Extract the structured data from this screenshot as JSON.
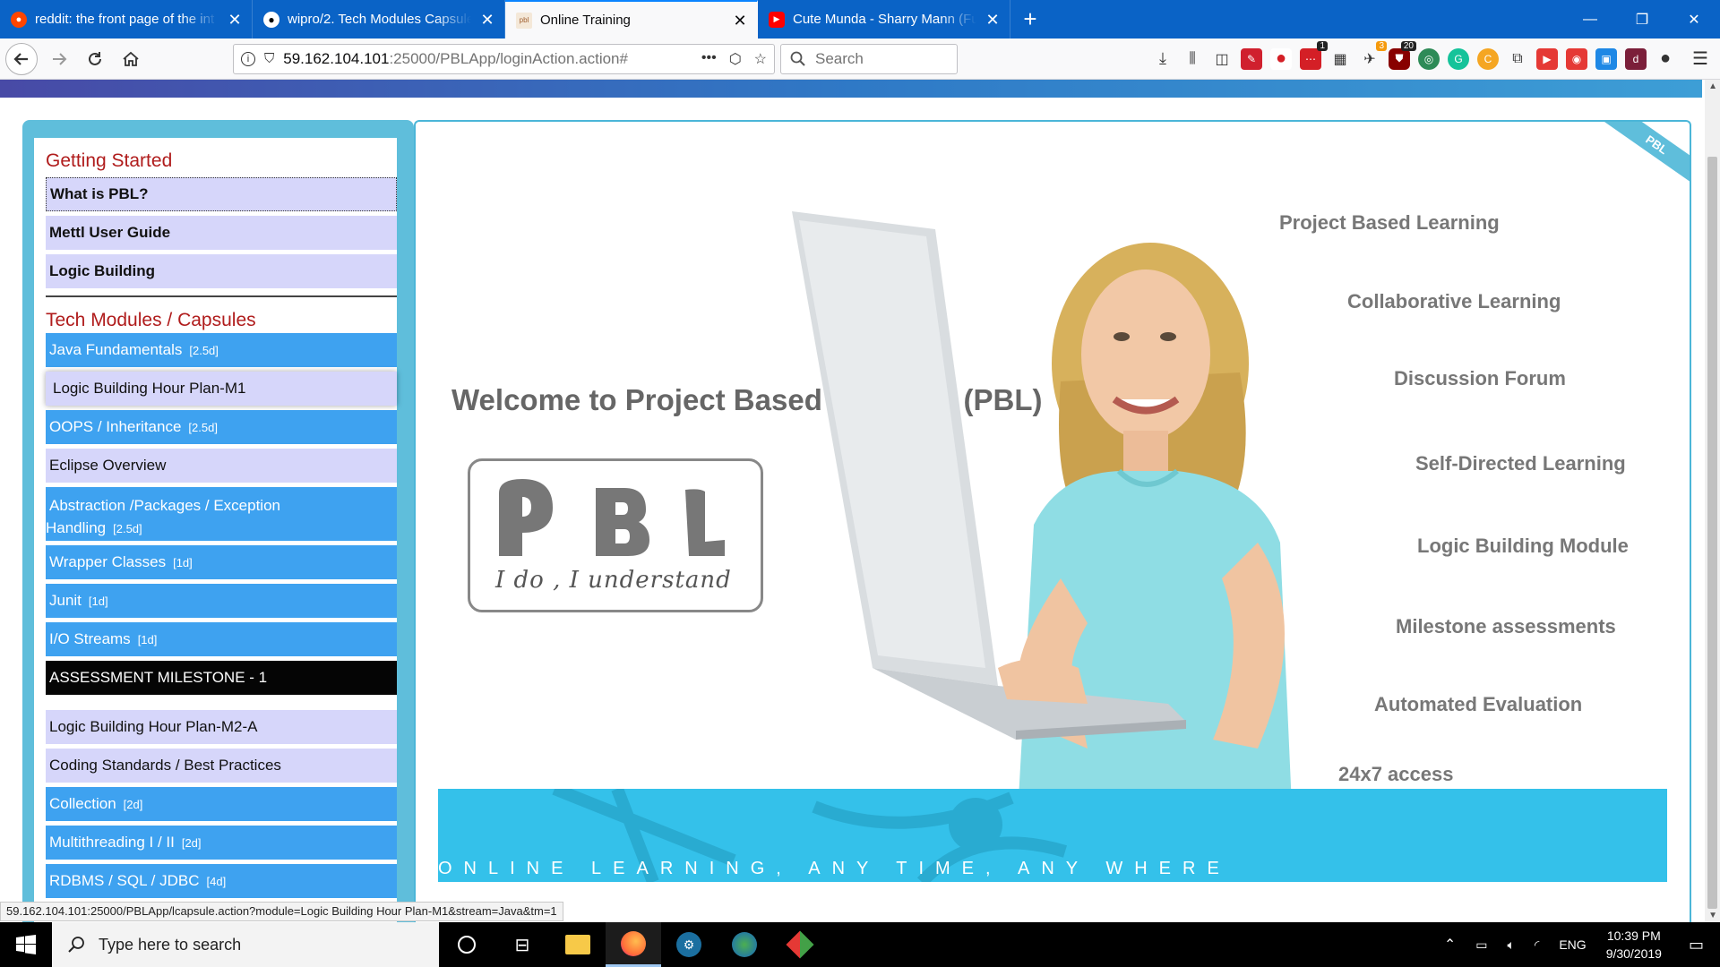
{
  "browser": {
    "tabs": [
      {
        "title": "reddit: the front page of the int",
        "icon": "reddit-icon",
        "active": false
      },
      {
        "title": "wipro/2. Tech Modules Capsule",
        "icon": "github-icon",
        "active": false
      },
      {
        "title": "Online Training",
        "icon": "pbl-favicon-icon",
        "active": true
      },
      {
        "title": "Cute Munda - Sharry Mann (Ful",
        "icon": "youtube-icon",
        "active": false
      }
    ],
    "url_host": "59.162.104.101",
    "url_path": ":25000/PBLApp/loginAction.action#",
    "search_placeholder": "Search",
    "ext_badges": {
      "first": "1",
      "second": "3",
      "third": "20"
    }
  },
  "sidebar": {
    "getting_started_title": "Getting Started",
    "getting_started": [
      {
        "label": "What is PBL?"
      },
      {
        "label": "Mettl User Guide"
      },
      {
        "label": "Logic Building"
      }
    ],
    "tech_title": "Tech Modules / Capsules",
    "modules": [
      {
        "label": "Java Fundamentals",
        "duration": "[2.5d]"
      },
      {
        "label": "Logic Building Hour Plan-M1",
        "duration": ""
      },
      {
        "label": "OOPS / Inheritance",
        "duration": "[2.5d]"
      },
      {
        "label": "Eclipse Overview",
        "duration": ""
      },
      {
        "label": "Abstraction /Packages / Exception",
        "label2": "Handling",
        "duration": "[2.5d]"
      },
      {
        "label": "Wrapper Classes",
        "duration": "[1d]"
      },
      {
        "label": "Junit",
        "duration": "[1d]"
      },
      {
        "label": "I/O Streams",
        "duration": "[1d]"
      },
      {
        "label": "ASSESSMENT MILESTONE - 1",
        "duration": ""
      },
      {
        "label": "Logic Building Hour Plan-M2-A",
        "duration": ""
      },
      {
        "label": "Coding Standards / Best Practices",
        "duration": ""
      },
      {
        "label": "Collection",
        "duration": "[2d]"
      },
      {
        "label": "Multithreading I / II",
        "duration": "[2d]"
      },
      {
        "label": "RDBMS / SQL / JDBC",
        "duration": "[4d]"
      }
    ]
  },
  "main": {
    "corner_label": "PBL",
    "welcome": "Welcome to Project Based Learning (PBL)",
    "logo_letters": "P B L",
    "logo_tagline": "I do , I understand",
    "features": [
      "Project Based Learning",
      "Collaborative Learning",
      "Discussion Forum",
      "Self-Directed Learning",
      "Logic Building Module",
      "Milestone assessments",
      "Automated Evaluation",
      "24x7 access"
    ],
    "banner_text": "ONLINE LEARNING, ANY TIME, ANY WHERE"
  },
  "status_url": "59.162.104.101:25000/PBLApp/lcapsule.action?module=Logic Building Hour Plan-M1&stream=Java&tm=1",
  "taskbar": {
    "search_placeholder": "Type here to search",
    "language": "ENG",
    "time": "10:39 PM",
    "date": "9/30/2019"
  },
  "colors": {
    "firefox_tabbar": "#0a63c6",
    "sidebar_frame": "#5fbedb",
    "section_title": "#b01c1c",
    "module_blue": "#3ea2f0",
    "module_light": "#d6d6fa",
    "banner": "#34c1ea"
  }
}
